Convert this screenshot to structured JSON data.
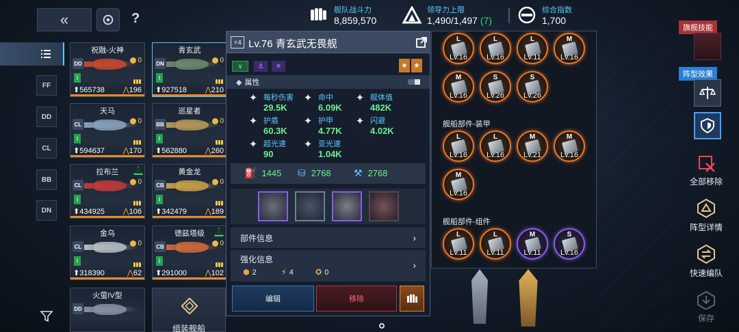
{
  "topbar": {
    "back_label": "«",
    "help_label": "?",
    "fleet_power_label": "舰队战斗力",
    "fleet_power_value": "8,859,570",
    "leadership_label": "领导力上限",
    "leadership_value": "1,490/1,497",
    "leadership_extra": "(7)",
    "composite_label": "综合指数",
    "composite_value": "1,700"
  },
  "left_nav": {
    "items": [
      "FF",
      "DD",
      "CL",
      "BB",
      "DN"
    ]
  },
  "ships": [
    {
      "name": "祝融-火神",
      "class": "DD",
      "power": "565738",
      "cost": "196",
      "stock": "0",
      "hull": "#c8492e"
    },
    {
      "name": "青玄武",
      "class": "DN",
      "power": "927518",
      "cost": "210",
      "stock": "0",
      "hull": "#6e8a6c"
    },
    {
      "name": "天马",
      "class": "CL",
      "power": "594637",
      "cost": "170",
      "stock": "0",
      "hull": "#8aa3bf"
    },
    {
      "name": "巡星者",
      "class": "BB",
      "power": "562880",
      "cost": "260",
      "stock": "0",
      "hull": "#b69a57"
    },
    {
      "name": "拉布兰",
      "class": "CL",
      "power": "434925",
      "cost": "106",
      "stock": "0",
      "hull": "#c23a3a"
    },
    {
      "name": "黄金龙",
      "class": "CB",
      "power": "342479",
      "cost": "189",
      "stock": "0",
      "hull": "#c9a146"
    },
    {
      "name": "金乌",
      "class": "CL",
      "power": "318390",
      "cost": "62",
      "stock": "0",
      "hull": "#b9bec6"
    },
    {
      "name": "德兹塔级",
      "class": "CB",
      "power": "291000",
      "cost": "102",
      "stock": "0",
      "hull": "#d06a3a"
    },
    {
      "name": "火萤IV型",
      "class": "DD",
      "power": "",
      "cost": "",
      "stock": "",
      "hull": "#8893a3"
    }
  ],
  "add_ship_label": "组装舰船",
  "detail": {
    "tier": "4",
    "title": "Lv.76 青玄武无畏舰",
    "section_attr": "属性",
    "attrs": [
      {
        "label": "每秒伤害",
        "value": "29.5K",
        "icon": "damage-icon"
      },
      {
        "label": "命中",
        "value": "6.09K",
        "icon": "crosshair-icon"
      },
      {
        "label": "舰体值",
        "value": "482K",
        "icon": "hull-icon"
      },
      {
        "label": "护盾",
        "value": "60.3K",
        "icon": "shield-icon"
      },
      {
        "label": "护甲",
        "value": "4.77K",
        "icon": "armor-icon"
      },
      {
        "label": "闪避",
        "value": "4.02K",
        "icon": "evade-icon"
      },
      {
        "label": "超光速",
        "value": "90",
        "icon": "warp-icon"
      },
      {
        "label": "亚光速",
        "value": "1.04K",
        "icon": "impulse-icon"
      }
    ],
    "cargo": [
      "1445",
      "2768",
      "2768"
    ],
    "parts_info_label": "部件信息",
    "enhance_label": "强化信息",
    "enhance": [
      "2",
      "4",
      "0"
    ],
    "edit_label": "编辑",
    "remove_label": "移除"
  },
  "parts": {
    "weapons": [
      {
        "type": "L",
        "lv": "Lv.16",
        "color": "orange"
      },
      {
        "type": "L",
        "lv": "Lv.16",
        "color": "orange"
      },
      {
        "type": "L",
        "lv": "Lv.11",
        "color": "orange"
      },
      {
        "type": "M",
        "lv": "Lv.16",
        "color": "orange"
      },
      {
        "type": "M",
        "lv": "Lv.16",
        "color": "orange"
      },
      {
        "type": "S",
        "lv": "Lv.26",
        "color": "orange"
      },
      {
        "type": "S",
        "lv": "Lv.26",
        "color": "orange"
      }
    ],
    "armor_title": "舰船部件-装甲",
    "armor": [
      {
        "type": "L",
        "lv": "Lv.16",
        "color": "orange"
      },
      {
        "type": "L",
        "lv": "Lv.16",
        "color": "orange"
      },
      {
        "type": "M",
        "lv": "Lv.21",
        "color": "orange"
      },
      {
        "type": "M",
        "lv": "Lv.16",
        "color": "orange"
      },
      {
        "type": "M",
        "lv": "Lv.16",
        "color": "orange"
      }
    ],
    "module_title": "舰船部件-组件",
    "modules": [
      {
        "type": "L",
        "lv": "Lv.11",
        "color": "orange"
      },
      {
        "type": "L",
        "lv": "Lv.11",
        "color": "orange"
      },
      {
        "type": "M",
        "lv": "Lv.11",
        "color": "purple"
      },
      {
        "type": "S",
        "lv": "Lv.16",
        "color": "purple"
      }
    ]
  },
  "right_panel": {
    "flagship_skill": "旗舰技能",
    "formation_effect": "阵型效果",
    "remove_all": "全部移除",
    "formation_detail": "阵型详情",
    "quick_edit": "快速编队",
    "save": "保存"
  }
}
